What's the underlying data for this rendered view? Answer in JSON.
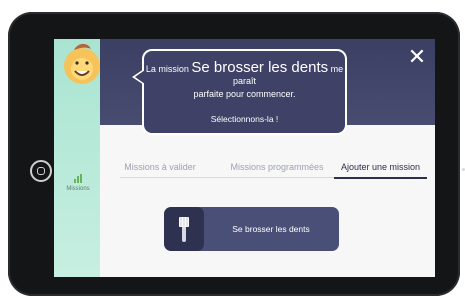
{
  "bubble": {
    "prefix": "La mission",
    "mission": "Se brosser les dents",
    "suffix": "me paraît",
    "line2": "parfaite pour commencer.",
    "cta": "Sélectionnons-la !"
  },
  "tabs": [
    {
      "label": "Missions à valider",
      "active": false
    },
    {
      "label": "Missions programmées",
      "active": false
    },
    {
      "label": "Ajouter une mission",
      "active": true
    }
  ],
  "sidebar": {
    "stat_label": "Missions"
  },
  "mission_card": {
    "label": "Se brosser les dents",
    "icon": "toothbrush-icon"
  },
  "icons": {
    "close": "close-icon",
    "home": "home-button-icon",
    "stats": "bar-chart-icon"
  },
  "colors": {
    "navy": "#3f4266",
    "teal": "#a9e4d1",
    "card": "#4a4f78"
  }
}
